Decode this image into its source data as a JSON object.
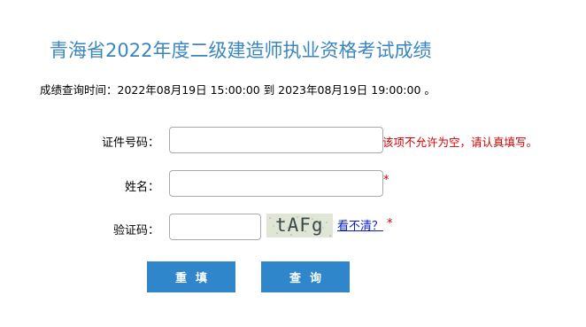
{
  "title": "青海省2022年度二级建造师执业资格考试成绩",
  "query_time": "成绩查询时间：2022年08月19日 15:00:00 到 2023年08月19日 19:00:00 。",
  "form": {
    "id_label": "证件号码：",
    "id_value": "",
    "id_error": "该项不允许为空，请认真填写。",
    "name_label": "姓名：",
    "name_value": "",
    "name_required": "*",
    "captcha_label": "验证码：",
    "captcha_value": "",
    "captcha_image_text": "tAFg",
    "captcha_refresh": "看不清？",
    "captcha_required": "*"
  },
  "buttons": {
    "reset": "重填",
    "query": "查询"
  },
  "colors": {
    "title": "#3a86bf",
    "button": "#2f86cb",
    "error": "#d10000",
    "link": "#0a1fcc"
  }
}
